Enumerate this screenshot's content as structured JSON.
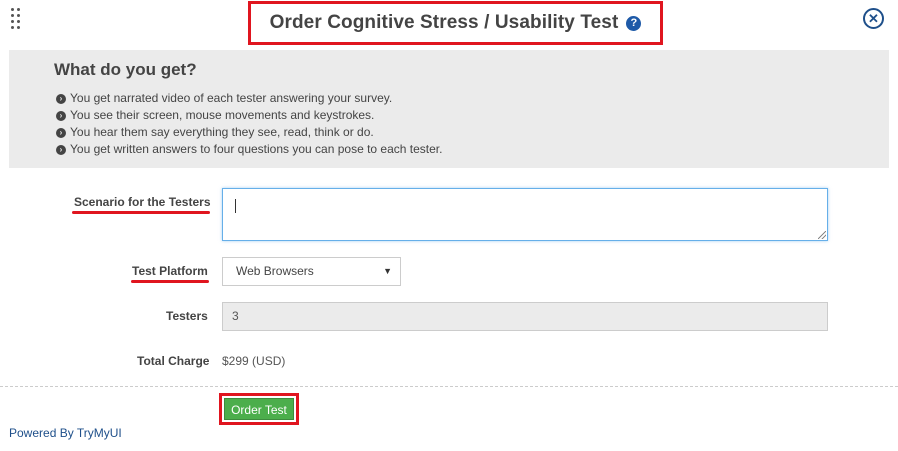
{
  "dialog": {
    "title": "Order Cognitive Stress / Usability Test",
    "help_icon": "question-circle-icon",
    "close_icon": "close-circle-icon",
    "drag_icon": "drag-handle-icon"
  },
  "info": {
    "heading": "What do you get?",
    "bullet_icon": "arrow-circle-right-icon",
    "items": [
      "You get narrated video of each tester answering your survey.",
      "You see their screen, mouse movements and keystrokes.",
      "You hear them say everything they see, read, think or do.",
      "You get written answers to four questions you can pose to each tester."
    ]
  },
  "form": {
    "scenario_label": "Scenario for the Testers",
    "scenario_value": "",
    "platform_label": "Test Platform",
    "platform_value": "Web Browsers",
    "testers_label": "Testers",
    "testers_value": "3",
    "charge_label": "Total Charge",
    "charge_value": "$299 (USD)"
  },
  "actions": {
    "order_label": "Order Test"
  },
  "footer": {
    "powered_by": "Powered By TryMyUI"
  },
  "colors": {
    "highlight": "#e0151f",
    "button_green": "#4cae4c",
    "link_blue": "#1e4f8a",
    "panel_gray": "#ebebeb"
  }
}
